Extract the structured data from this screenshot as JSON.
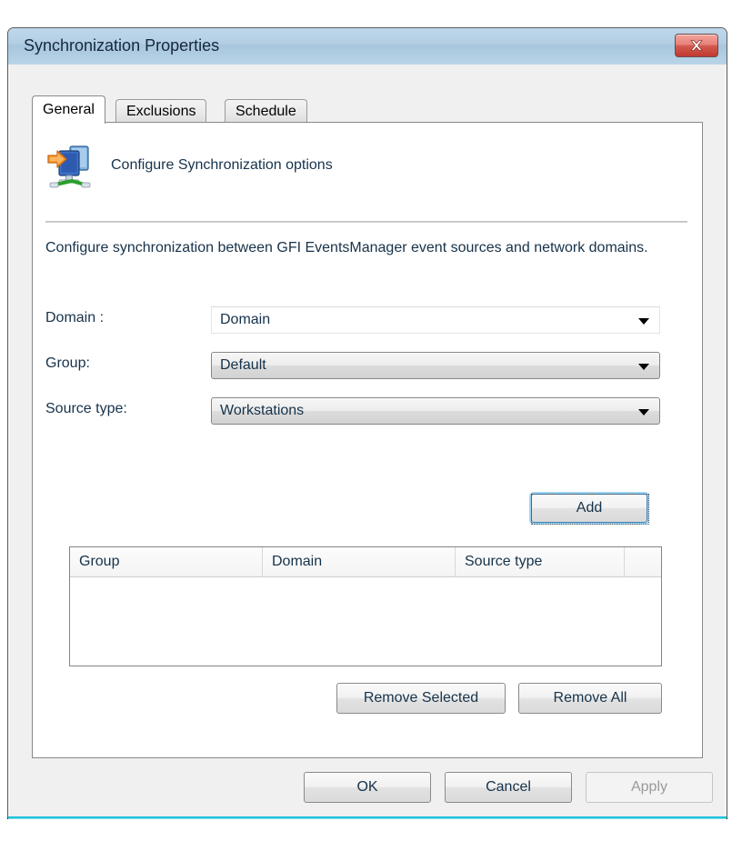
{
  "window": {
    "title": "Synchronization Properties",
    "close_label": "Close"
  },
  "tabs": [
    {
      "label": "General",
      "active": true
    },
    {
      "label": "Exclusions",
      "active": false
    },
    {
      "label": "Schedule",
      "active": false
    }
  ],
  "panel": {
    "icon": "sync-computers-icon",
    "caption": "Configure Synchronization options",
    "description": "Configure synchronization between GFI EventsManager event sources and network domains."
  },
  "form": {
    "rows": [
      {
        "label": "Domain :",
        "value": "Domain",
        "style": "editable",
        "name": "domain"
      },
      {
        "label": "Group:",
        "value": "Default",
        "style": "dropdown",
        "name": "group"
      },
      {
        "label": "Source type:",
        "value": "Workstations",
        "style": "dropdown",
        "name": "source-type"
      }
    ],
    "add_label": "Add"
  },
  "table": {
    "columns": [
      "Group",
      "Domain",
      "Source type",
      ""
    ],
    "rows": []
  },
  "actions": {
    "remove_selected": "Remove Selected",
    "remove_all": "Remove All"
  },
  "footer": {
    "ok": "OK",
    "cancel": "Cancel",
    "apply": "Apply",
    "apply_disabled": true
  },
  "colors": {
    "titlebar": "#b3cee4",
    "close_button": "#c0392f",
    "accent_focus": "#9fd4f2",
    "text": "#16324a",
    "window_bg": "#f0f0f0",
    "bottom_edge": "#00b9d4"
  }
}
